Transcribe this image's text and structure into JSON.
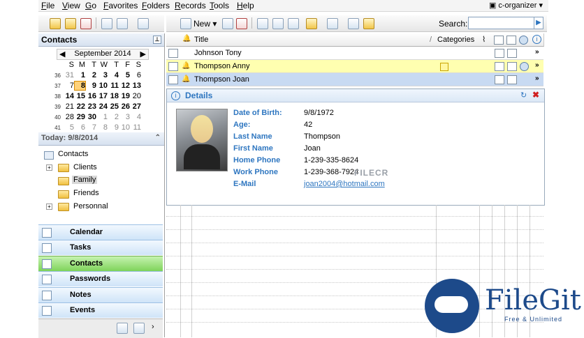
{
  "menu": [
    "File",
    "View",
    "Go",
    "Favorites",
    "Folders",
    "Records",
    "Tools",
    "Help"
  ],
  "app_switch": "c-organizer",
  "toolbar": {
    "new_label": "New",
    "search_label": "Search:"
  },
  "contacts_panel_title": "Contacts",
  "calendar": {
    "month": "September 2014",
    "weekday_headers": [
      "S",
      "M",
      "T",
      "W",
      "T",
      "F",
      "S"
    ],
    "weeks": [
      {
        "week": "36",
        "days": [
          "31",
          "1",
          "2",
          "3",
          "4",
          "5",
          "6"
        ]
      },
      {
        "week": "37",
        "days": [
          "7",
          "8",
          "9",
          "10",
          "11",
          "12",
          "13"
        ]
      },
      {
        "week": "38",
        "days": [
          "14",
          "15",
          "16",
          "17",
          "18",
          "19",
          "20"
        ]
      },
      {
        "week": "39",
        "days": [
          "21",
          "22",
          "23",
          "24",
          "25",
          "26",
          "27"
        ]
      },
      {
        "week": "40",
        "days": [
          "28",
          "29",
          "30",
          "1",
          "2",
          "3",
          "4"
        ]
      },
      {
        "week": "41",
        "days": [
          "5",
          "6",
          "7",
          "8",
          "9",
          "10",
          "11"
        ]
      }
    ],
    "selected_day": "8"
  },
  "today": "Today: 9/8/2014",
  "tree": {
    "root": "Contacts",
    "items": [
      "Clients",
      "Family",
      "Friends",
      "Personnal"
    ]
  },
  "nav_buttons": [
    "Calendar",
    "Tasks",
    "Contacts",
    "Passwords",
    "Notes",
    "Events"
  ],
  "active_nav": "Contacts",
  "grid": {
    "headers": {
      "title": "Title",
      "categories": "Categories"
    },
    "rows": [
      "Johnson Tony",
      "Thompson Anny",
      "Thompson Joan"
    ]
  },
  "details": {
    "title": "Details",
    "fields": [
      {
        "label": "Date of Birth:",
        "value": "9/8/1972"
      },
      {
        "label": "Age:",
        "value": "42"
      },
      {
        "label": "Last Name",
        "value": "Thompson"
      },
      {
        "label": "First Name",
        "value": "Joan"
      },
      {
        "label": "Home Phone",
        "value": "1-239-335-8624"
      },
      {
        "label": "Work Phone",
        "value": "1-239-368-7924"
      },
      {
        "label": "E-Mail",
        "value": "joan2004@hotmail.com"
      }
    ]
  },
  "watermark": {
    "filecr": "FILECR",
    "filegit": "FileGit",
    "filegit_sub": "Free & Unlimited"
  },
  "colors": {
    "accent": "#2e76c0",
    "active_nav": "#7ed35a",
    "selected_row": "#ffffb0"
  }
}
